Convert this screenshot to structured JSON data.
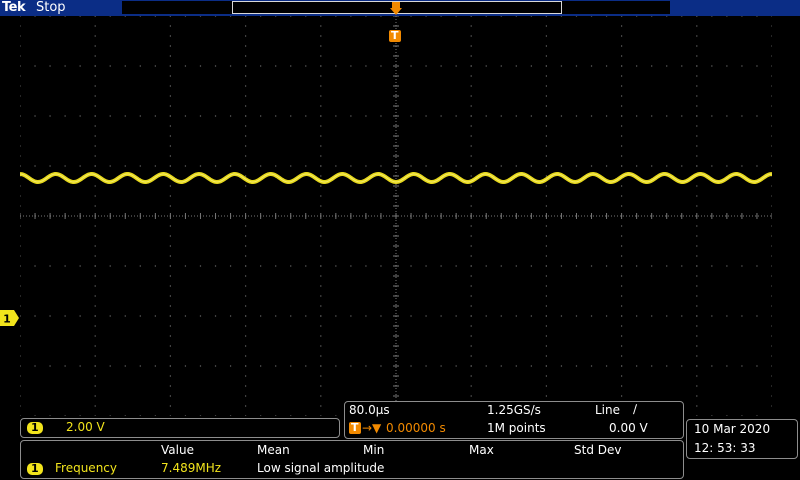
{
  "header": {
    "brand": "Tek",
    "acquisition_state": "Stop"
  },
  "colors": {
    "channel1": "#f2e41c",
    "trigger": "#f28a00",
    "header_bg": "#0b2d86"
  },
  "markers": {
    "trigger_label": "T",
    "channel1_label": "1"
  },
  "channel1": {
    "label": "1",
    "scale": "2.00 V"
  },
  "timebase": {
    "horizontal_scale": "80.0µs",
    "sample_rate": "1.25GS/s",
    "trigger_source": "Line",
    "trigger_slope_icon": "rising-edge-icon",
    "trigger_slope_glyph": "∕",
    "trigger_label": "T",
    "position_arrow": "→▼",
    "position_value": "0.00000 s",
    "record_length": "1M points",
    "trigger_level": "0.00 V"
  },
  "datetime": {
    "date": "10 Mar   2020",
    "time": "12: 53: 33"
  },
  "measurements": {
    "headers": [
      "Value",
      "Mean",
      "Min",
      "Max",
      "Std Dev"
    ],
    "rows": [
      {
        "channel": "1",
        "name": "Frequency",
        "value": "7.489MHz",
        "note": "Low signal amplitude"
      }
    ]
  },
  "waveform": {
    "channel": "1",
    "shape": "sine",
    "cycles_on_screen": 21
  }
}
